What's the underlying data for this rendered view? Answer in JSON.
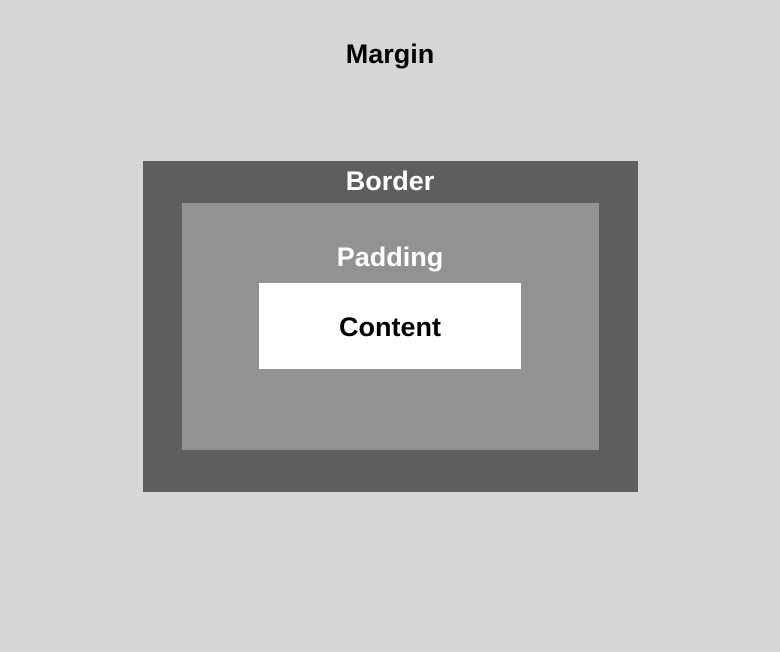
{
  "labels": {
    "margin": "Margin",
    "border": "Border",
    "padding": "Padding",
    "content": "Content"
  },
  "colors": {
    "margin": "#d6d6d6",
    "border": "#5e5e5e",
    "padding": "#929292",
    "content": "#ffffff"
  }
}
